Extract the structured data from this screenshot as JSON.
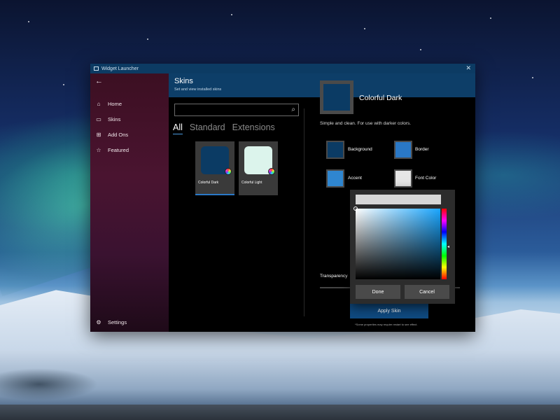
{
  "window": {
    "title": "Widget Launcher",
    "close_glyph": "✕"
  },
  "sidebar": {
    "back_glyph": "←",
    "items": [
      {
        "label": "Home",
        "icon": "home-icon",
        "glyph": "⌂"
      },
      {
        "label": "Skins",
        "icon": "skins-icon",
        "glyph": "▭"
      },
      {
        "label": "Add Ons",
        "icon": "add-ons-icon",
        "glyph": "⊞"
      },
      {
        "label": "Featured",
        "icon": "star-icon",
        "glyph": "☆"
      }
    ],
    "settings": {
      "label": "Settings",
      "icon": "gear-icon",
      "glyph": "⚙"
    }
  },
  "header": {
    "title": "Skins",
    "subtitle": "Set and view installed skins"
  },
  "search": {
    "value": "",
    "placeholder": "",
    "icon_glyph": "⌕"
  },
  "tabs": [
    {
      "label": "All",
      "active": true
    },
    {
      "label": "Standard",
      "active": false
    },
    {
      "label": "Extensions",
      "active": false
    }
  ],
  "skins": [
    {
      "label": "Colorful Dark",
      "color": "#0b3b64",
      "selected": true
    },
    {
      "label": "Colorful Light",
      "color": "#dcf4ec",
      "selected": false
    }
  ],
  "detail": {
    "title": "Colorful Dark",
    "description": "Simple and clean. For use with darker colors.",
    "preview_color": "#0b3b64",
    "colors": [
      {
        "label": "Background",
        "value": "#0b3b64"
      },
      {
        "label": "Border",
        "value": "#2a78c6"
      },
      {
        "label": "Accent",
        "value": "#2f86d0"
      },
      {
        "label": "Font Color",
        "value": "#e6e6e6"
      }
    ],
    "transparency_label": "Transparency",
    "apply_label": "Apply Skin",
    "footnote": "*Some properties may require restart to see effect."
  },
  "color_picker": {
    "hex_value": "",
    "done_label": "Done",
    "cancel_label": "Cancel",
    "hue_color": "#1aa6ff"
  }
}
